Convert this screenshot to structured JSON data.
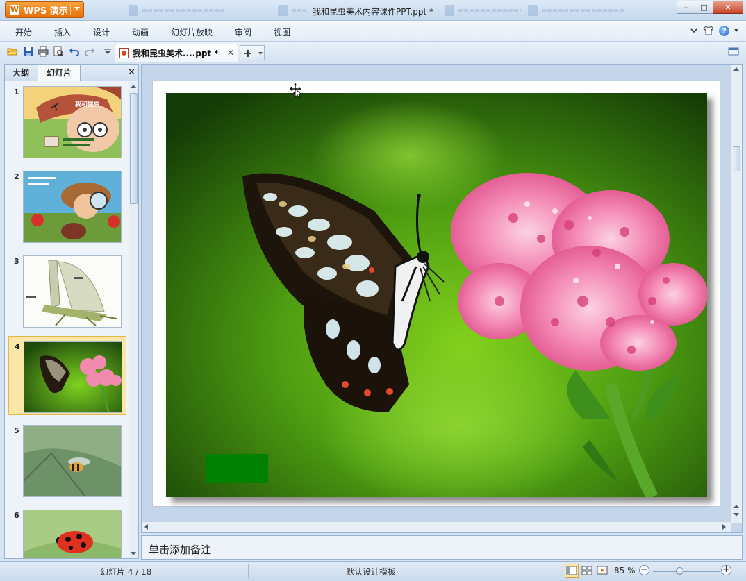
{
  "window": {
    "title": "我和昆虫美术内容课件PPT.ppt *",
    "app_button_label": "WPS 演示",
    "app_button_logo": "W",
    "controls": {
      "minimize": "–",
      "maximize": "□",
      "close": "✕"
    }
  },
  "menu": {
    "items": [
      "开始",
      "插入",
      "设计",
      "动画",
      "幻灯片放映",
      "审阅",
      "视图"
    ],
    "right_icons": [
      "chevron-down-icon",
      "shirt-skin-icon",
      "help-icon"
    ],
    "help_glyph": "?"
  },
  "toolbar": {
    "icons": [
      "open-folder-icon",
      "save-icon",
      "print-icon",
      "print-preview-icon",
      "undo-icon",
      "redo-icon",
      "customize-dropdown-icon"
    ],
    "doc_tab": {
      "label": "我和昆虫美术....ppt *",
      "close": "✕"
    },
    "new_tab": {
      "plus": "+"
    }
  },
  "left_panel": {
    "tabs": [
      "大纲",
      "幻灯片"
    ],
    "active_tab": "幻灯片",
    "close": "✕",
    "slides": [
      {
        "number": "1",
        "title_text": "我和昆虫"
      },
      {
        "number": "2",
        "title_text": ""
      },
      {
        "number": "3",
        "title_text": ""
      },
      {
        "number": "4",
        "title_text": "",
        "selected": true
      },
      {
        "number": "5",
        "title_text": ""
      },
      {
        "number": "6",
        "title_text": ""
      }
    ]
  },
  "notes": {
    "placeholder": "单击添加备注"
  },
  "status": {
    "slide_indicator": "幻灯片 4 / 18",
    "template": "默认设计模板",
    "zoom": "85 %",
    "zoom_level_percent": 85,
    "zoom_minus": "−",
    "zoom_plus": "+",
    "view_buttons": [
      "normal-view-icon",
      "slide-sorter-icon",
      "slideshow-icon"
    ]
  },
  "colors": {
    "accent_orange": "#e56f0a",
    "selection_yellow": "#fbe7a8",
    "frame_blue": "#98b2d2",
    "green_box": "#008000"
  }
}
